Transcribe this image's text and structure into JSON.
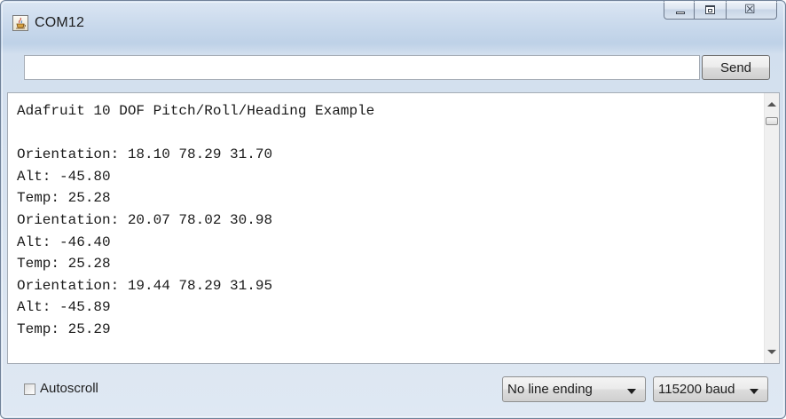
{
  "window": {
    "title": "COM12",
    "app_icon": "java-cup-icon",
    "caption_buttons": [
      "minimize-icon",
      "maximize-icon",
      "close-icon"
    ],
    "close_glyph": "☒"
  },
  "input_row": {
    "input_value": "",
    "send_label": "Send"
  },
  "output": {
    "lines": [
      "Adafruit 10 DOF Pitch/Roll/Heading Example",
      "",
      "Orientation: 18.10 78.29 31.70",
      "Alt: -45.80",
      "Temp: 25.28",
      "Orientation: 20.07 78.02 30.98",
      "Alt: -46.40",
      "Temp: 25.28",
      "Orientation: 19.44 78.29 31.95",
      "Alt: -45.89",
      "Temp: 25.29"
    ]
  },
  "bottom_bar": {
    "autoscroll_label": "Autoscroll",
    "autoscroll_checked": false,
    "line_ending_selected": "No line ending",
    "baud_selected": "115200 baud"
  },
  "colors": {
    "frame_border": "#6f8198",
    "frame_tint": "#c9d9ec",
    "text": "#1a1a1a"
  }
}
